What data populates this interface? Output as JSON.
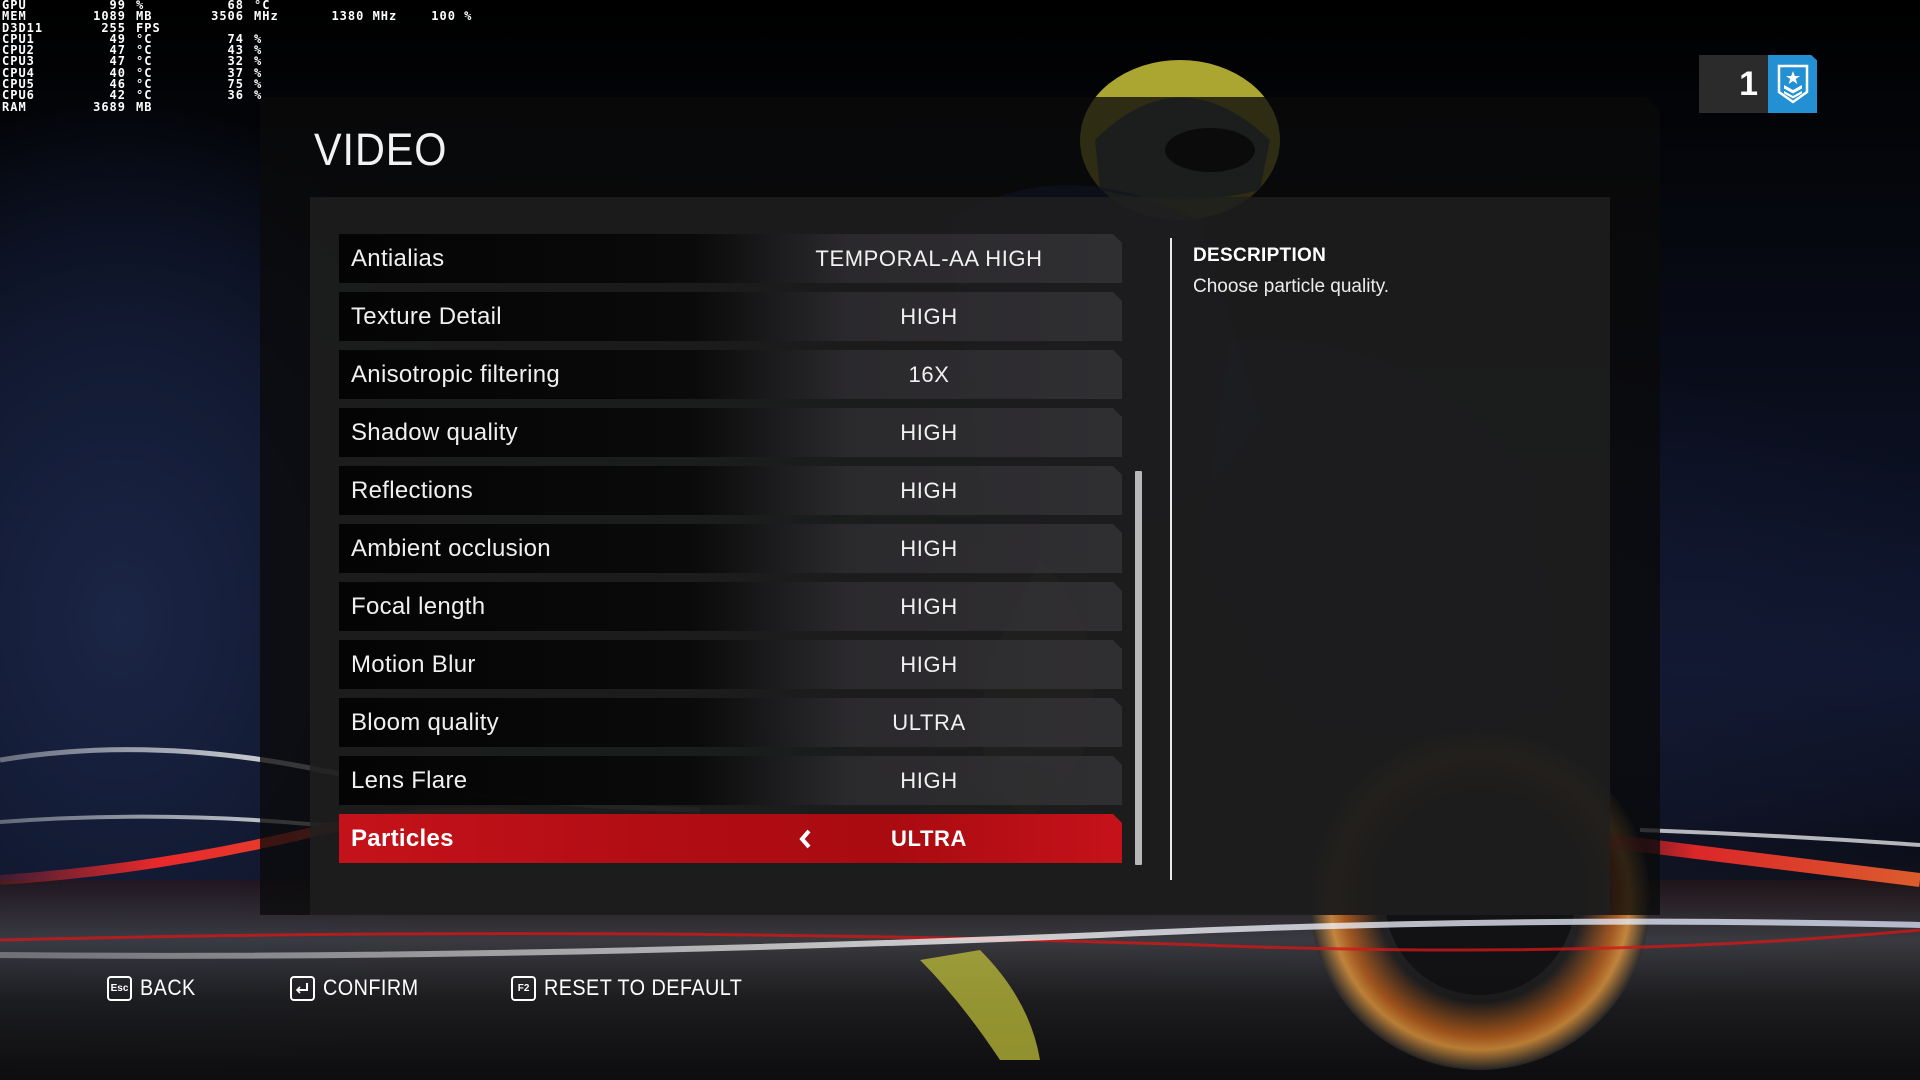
{
  "osd": {
    "rows": [
      {
        "label": "GPU",
        "v1": "99",
        "u1": "%",
        "v2": "68",
        "u2": "°C"
      },
      {
        "label": "MEM",
        "v1": "1089",
        "u1": "MB",
        "v2": "3506",
        "u2": "MHz"
      },
      {
        "label": "D3D11",
        "v1": "255",
        "u1": "FPS",
        "v2": "",
        "u2": ""
      },
      {
        "label": "CPU1",
        "v1": "49",
        "u1": "°C",
        "v2": "74",
        "u2": "%"
      },
      {
        "label": "CPU2",
        "v1": "47",
        "u1": "°C",
        "v2": "43",
        "u2": "%"
      },
      {
        "label": "CPU3",
        "v1": "47",
        "u1": "°C",
        "v2": "32",
        "u2": "%"
      },
      {
        "label": "CPU4",
        "v1": "40",
        "u1": "°C",
        "v2": "37",
        "u2": "%"
      },
      {
        "label": "CPU5",
        "v1": "46",
        "u1": "°C",
        "v2": "75",
        "u2": "%"
      },
      {
        "label": "CPU6",
        "v1": "42",
        "u1": "°C",
        "v2": "36",
        "u2": "%"
      },
      {
        "label": "RAM",
        "v1": "3689",
        "u1": "MB",
        "v2": "",
        "u2": ""
      }
    ],
    "gpu_clock": "1380 MHz",
    "gpu_power": "100 %"
  },
  "rank_badge": {
    "number": "1",
    "icon": "chevron-rank-star-icon",
    "color": "#2290d2"
  },
  "page_title": "VIDEO",
  "settings": [
    {
      "label": "Antialias",
      "value": "TEMPORAL-AA HIGH"
    },
    {
      "label": "Texture Detail",
      "value": "HIGH"
    },
    {
      "label": "Anisotropic filtering",
      "value": "16X"
    },
    {
      "label": "Shadow quality",
      "value": "HIGH"
    },
    {
      "label": "Reflections",
      "value": "HIGH"
    },
    {
      "label": "Ambient occlusion",
      "value": "HIGH"
    },
    {
      "label": "Focal length",
      "value": "HIGH"
    },
    {
      "label": "Motion Blur",
      "value": "HIGH"
    },
    {
      "label": "Bloom quality",
      "value": "ULTRA"
    },
    {
      "label": "Lens Flare",
      "value": "HIGH"
    },
    {
      "label": "Particles",
      "value": "ULTRA",
      "selected": true
    }
  ],
  "selected_color": "#c5121a",
  "description": {
    "heading": "DESCRIPTION",
    "text": "Choose particle quality."
  },
  "footer": [
    {
      "key": "Esc",
      "label": "BACK"
    },
    {
      "key": "enter-icon",
      "label": "CONFIRM"
    },
    {
      "key": "F2",
      "label": "RESET TO DEFAULT"
    }
  ]
}
